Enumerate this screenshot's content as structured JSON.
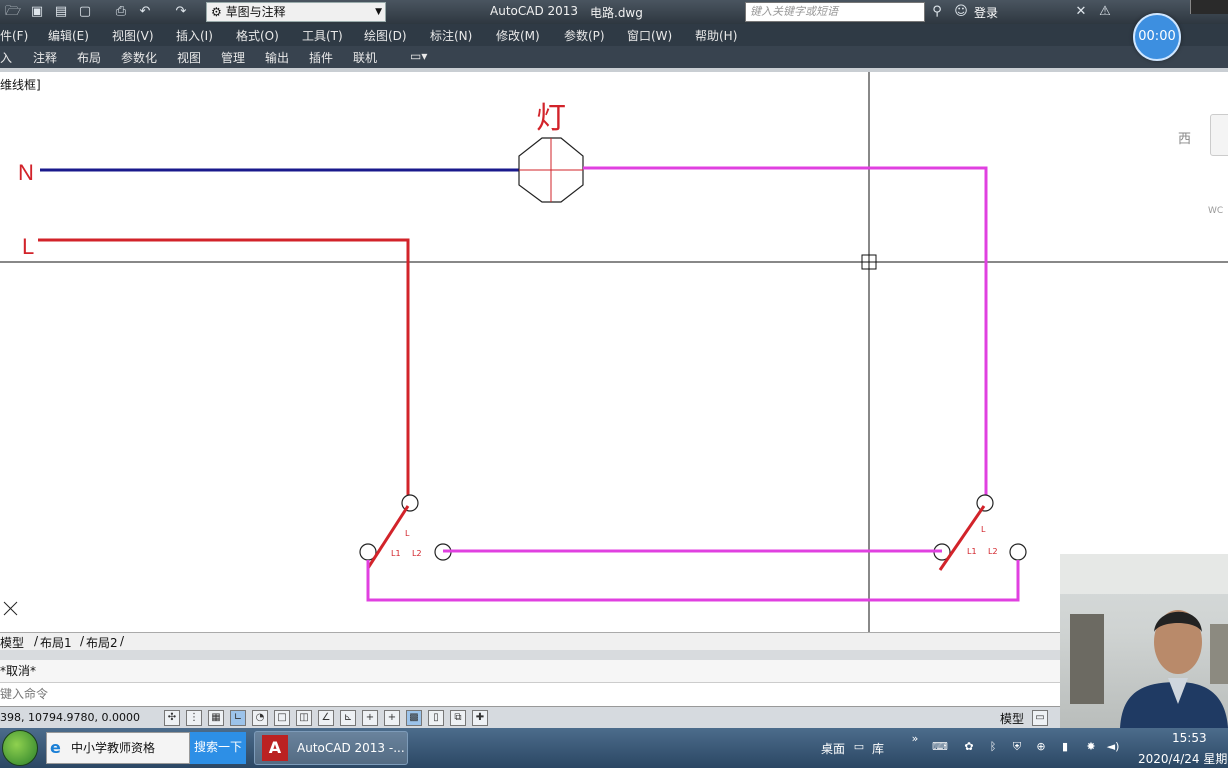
{
  "titlebar": {
    "workspace": "草图与注释",
    "app_name": "AutoCAD 2013",
    "file_name": "电路.dwg",
    "search_placeholder": "键入关键字或短语",
    "login": "登录",
    "timer": "00:00"
  },
  "menu": [
    "件(F)",
    "编辑(E)",
    "视图(V)",
    "插入(I)",
    "格式(O)",
    "工具(T)",
    "绘图(D)",
    "标注(N)",
    "修改(M)",
    "参数(P)",
    "窗口(W)",
    "帮助(H)"
  ],
  "ribbon_tabs": [
    "入",
    "注释",
    "布局",
    "参数化",
    "视图",
    "管理",
    "输出",
    "插件",
    "联机"
  ],
  "viewport_label": "维线框]",
  "viewcube": {
    "west": "西",
    "wcs": "WC"
  },
  "drawing": {
    "lamp_label": "灯",
    "neutral_label": "N",
    "live_label": "L",
    "switch_left": {
      "common": "L",
      "t1": "L1",
      "t2": "L2"
    },
    "switch_right": {
      "common": "L",
      "t1": "L1",
      "t2": "L2"
    },
    "colors": {
      "neutral": "#1a1a8c",
      "live": "#d2232a",
      "switched": "#e040e0",
      "lamp_label": "#d2232a"
    }
  },
  "layout_tabs": [
    "模型",
    "布局1",
    "布局2"
  ],
  "command": {
    "history": "*取消*",
    "prompt": "键入命令"
  },
  "status": {
    "coords": "398, 10794.9780, 0.0000",
    "model": "模型"
  },
  "taskbar": {
    "ie_label": "中小学教师资格",
    "search_label": "搜索一下",
    "acad_label": "AutoCAD 2013 -...",
    "desktop": "桌面",
    "library": "库",
    "time": "15:53",
    "date": "2020/4/24 星期"
  }
}
